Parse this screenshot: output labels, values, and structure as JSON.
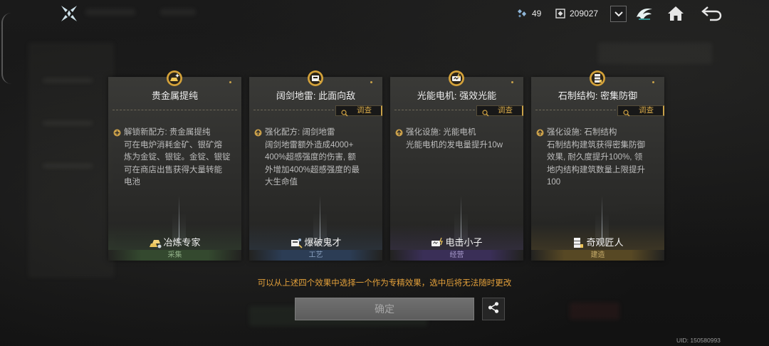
{
  "topbar": {
    "logo_icon": "crossed-blades-logo-icon",
    "resources": [
      {
        "icon": "crystal-cluster-icon",
        "value": "49"
      },
      {
        "icon": "cube-token-icon",
        "value": "209027"
      }
    ],
    "dropdown_icon": "chevron-down-icon",
    "emblem_icon": "wave-emblem-icon",
    "home_icon": "home-icon",
    "back_icon": "back-arrow-icon"
  },
  "investigate_label": "调查",
  "cards": [
    {
      "icon": "gold-ingot-badge-icon",
      "title": "贵金属提纯",
      "effect_icon": "unlock-plus-icon",
      "effect_header": "解锁新配方: 贵金属提纯",
      "effect_lines": [
        "可在电炉消耗金矿、银矿熔",
        "炼为金锭、银锭。金锭、银锭",
        "可在商店出售获得大量转能",
        "电池"
      ],
      "talent": {
        "icon": "smelting-icon",
        "name": "冶炼专家"
      },
      "category": {
        "label": "采集",
        "color": "#34492f",
        "text_color": "#8fae86"
      }
    },
    {
      "icon": "mine-box-badge-icon",
      "title": "阔剑地雷: 此面向敌",
      "effect_icon": "upgrade-arrow-icon",
      "effect_header": "强化配方: 阔剑地雷",
      "effect_lines": [
        "阔剑地雷额外造成4000+",
        "400%超感强度的伤害, 额",
        "外增加400%超感强度的最",
        "大生命值"
      ],
      "talent": {
        "icon": "demolition-icon",
        "name": "爆破鬼才"
      },
      "category": {
        "label": "工艺",
        "color": "#2c3d55",
        "text_color": "#8ba3c2"
      }
    },
    {
      "icon": "motor-badge-icon",
      "title": "光能电机: 强效光能",
      "effect_icon": "upgrade-arrow-icon",
      "effect_header": "强化设施: 光能电机",
      "effect_lines": [
        "光能电机的发电量提升10w"
      ],
      "talent": {
        "icon": "electric-icon",
        "name": "电击小子"
      },
      "category": {
        "label": "经营",
        "color": "#3a2f57",
        "text_color": "#a698cb"
      }
    },
    {
      "icon": "stone-structure-badge-icon",
      "title": "石制结构: 密集防御",
      "effect_icon": "upgrade-arrow-icon",
      "effect_header": "强化设施: 石制结构",
      "effect_lines": [
        "石制结构建筑获得密集防御",
        "效果, 耐久度提升100%, 领",
        "地内结构建筑数量上限提升",
        "100"
      ],
      "talent": {
        "icon": "builder-icon",
        "name": "奇观匠人"
      },
      "category": {
        "label": "建造",
        "color": "#574824",
        "text_color": "#c9ae6b"
      }
    }
  ],
  "notice": "可以从上述四个效果中选择一个作为专精效果，选中后将无法随时更改",
  "confirm_button": {
    "label": "确定",
    "state": "disabled"
  },
  "share_icon": "share-icon",
  "uid": "UID: 150580993",
  "colors": {
    "accent_gold": "#d5a849",
    "notice_text": "#e3a03a",
    "card_text": "#bcbcbc",
    "title_text": "#eeeeee",
    "confirm_disabled": "#666666"
  }
}
